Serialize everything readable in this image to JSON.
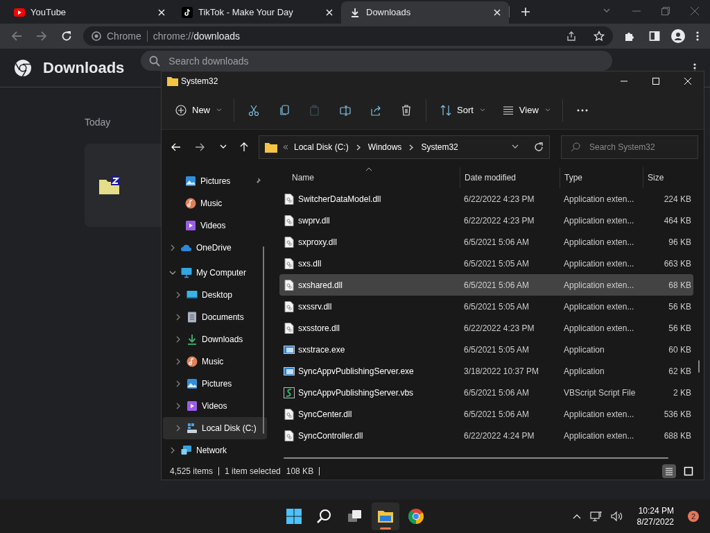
{
  "browser": {
    "tabs": [
      {
        "title": "YouTube",
        "selected": false
      },
      {
        "title": "TikTok - Make Your Day",
        "selected": false
      },
      {
        "title": "Downloads",
        "selected": true
      }
    ],
    "omnibox": {
      "site": "Chrome",
      "url": "chrome://**downloads**"
    }
  },
  "downloads_page": {
    "title": "Downloads",
    "search": {
      "placeholder": "Search downloads"
    },
    "section": "Today"
  },
  "explorer": {
    "title": "System32",
    "toolbar": [
      {
        "kind": "new",
        "label": "New",
        "disabled": false
      },
      {
        "kind": "cut",
        "disabled": false
      },
      {
        "kind": "copy",
        "disabled": false
      },
      {
        "kind": "paste",
        "disabled": true
      },
      {
        "kind": "rename",
        "disabled": false
      },
      {
        "kind": "share",
        "disabled": false
      },
      {
        "kind": "delete",
        "disabled": false
      },
      {
        "kind": "sort",
        "label": "Sort",
        "disabled": false
      },
      {
        "kind": "view",
        "label": "View",
        "disabled": false
      },
      {
        "kind": "more",
        "disabled": false
      }
    ],
    "breadcrumb": [
      "Local Disk (C:)",
      "Windows",
      "System32"
    ],
    "search": {
      "placeholder": "Search System32"
    },
    "nav": [
      {
        "label": "Pictures",
        "kind": "pictures",
        "pinned": true,
        "selected": false
      },
      {
        "label": "Music",
        "kind": "music",
        "pinned": false,
        "selected": false
      },
      {
        "label": "Videos",
        "kind": "videos",
        "pinned": false,
        "selected": false
      },
      {
        "label": "OneDrive",
        "kind": "cloud",
        "expanded": false,
        "selected": false
      },
      {
        "label": "My Computer",
        "kind": "computer",
        "expanded": true,
        "selected": false,
        "children": [
          {
            "label": "Desktop",
            "kind": "desktop",
            "expanded": false,
            "selected": false
          },
          {
            "label": "Documents",
            "kind": "documents",
            "expanded": false,
            "selected": false
          },
          {
            "label": "Downloads",
            "kind": "downloads",
            "expanded": false,
            "selected": false
          },
          {
            "label": "Music",
            "kind": "music",
            "expanded": false,
            "selected": false
          },
          {
            "label": "Pictures",
            "kind": "pictures",
            "expanded": false,
            "selected": false
          },
          {
            "label": "Videos",
            "kind": "videos",
            "expanded": false,
            "selected": false
          },
          {
            "label": "Local Disk (C:)",
            "kind": "disk",
            "expanded": false,
            "selected": true
          }
        ]
      },
      {
        "label": "Network",
        "kind": "network",
        "expanded": false,
        "selected": false
      }
    ],
    "columns": [
      {
        "label": "Name",
        "sorted": true
      },
      {
        "label": "Date modified",
        "sorted": false
      },
      {
        "label": "Type",
        "sorted": false
      },
      {
        "label": "Size",
        "sorted": false
      }
    ],
    "rows": [
      {
        "name": "SwitcherDataModel.dll",
        "kind": "dll",
        "date": "6/22/2022 4:23 PM",
        "type": "Application exten...",
        "size": "224 KB",
        "selected": false
      },
      {
        "name": "swprv.dll",
        "kind": "dll",
        "date": "6/22/2022 4:23 PM",
        "type": "Application exten...",
        "size": "464 KB",
        "selected": false
      },
      {
        "name": "sxproxy.dll",
        "kind": "dll",
        "date": "6/5/2021 5:06 AM",
        "type": "Application exten...",
        "size": "96 KB",
        "selected": false
      },
      {
        "name": "sxs.dll",
        "kind": "dll",
        "date": "6/5/2021 5:05 AM",
        "type": "Application exten...",
        "size": "663 KB",
        "selected": false
      },
      {
        "name": "sxshared.dll",
        "kind": "dll",
        "date": "6/5/2021 5:06 AM",
        "type": "Application exten...",
        "size": "68 KB",
        "selected": true
      },
      {
        "name": "sxssrv.dll",
        "kind": "dll",
        "date": "6/5/2021 5:05 AM",
        "type": "Application exten...",
        "size": "56 KB",
        "selected": false
      },
      {
        "name": "sxsstore.dll",
        "kind": "dll",
        "date": "6/22/2022 4:23 PM",
        "type": "Application exten...",
        "size": "56 KB",
        "selected": false
      },
      {
        "name": "sxstrace.exe",
        "kind": "exe",
        "date": "6/5/2021 5:05 AM",
        "type": "Application",
        "size": "60 KB",
        "selected": false
      },
      {
        "name": "SyncAppvPublishingServer.exe",
        "kind": "exe",
        "date": "3/18/2022 10:37 PM",
        "type": "Application",
        "size": "62 KB",
        "selected": false
      },
      {
        "name": "SyncAppvPublishingServer.vbs",
        "kind": "vbs",
        "date": "6/5/2021 5:06 AM",
        "type": "VBScript Script File",
        "size": "2 KB",
        "selected": false
      },
      {
        "name": "SyncCenter.dll",
        "kind": "dll",
        "date": "6/5/2021 5:06 AM",
        "type": "Application exten...",
        "size": "536 KB",
        "selected": false
      },
      {
        "name": "SyncController.dll",
        "kind": "dll",
        "date": "6/22/2022 4:24 PM",
        "type": "Application exten...",
        "size": "688 KB",
        "selected": false
      }
    ],
    "status": {
      "count": "4,525 items",
      "selection": "1 item selected",
      "size": "108 KB"
    },
    "views": [
      {
        "kind": "details",
        "selected": true
      },
      {
        "kind": "tiles",
        "selected": false
      }
    ]
  },
  "taskbar": {
    "apps": [
      {
        "kind": "start",
        "active": false
      },
      {
        "kind": "search",
        "active": false
      },
      {
        "kind": "taskview",
        "active": false
      },
      {
        "kind": "explorer",
        "active": true
      },
      {
        "kind": "chrome",
        "active": false
      }
    ],
    "time": "10:24 PM",
    "date": "8/27/2022",
    "notifications": "2"
  }
}
